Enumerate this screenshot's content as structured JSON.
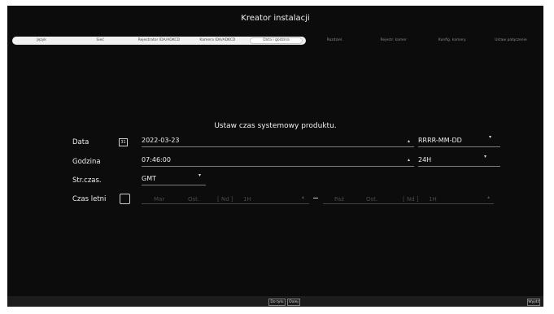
{
  "window": {
    "title": "Kreator instalacji"
  },
  "steps": [
    {
      "label": "Język",
      "state": "done"
    },
    {
      "label": "Sieć",
      "state": "done"
    },
    {
      "label": "Rejestrator IDA/ADKCD",
      "state": "done"
    },
    {
      "label": "Kamera IDA/ADKCD",
      "state": "done"
    },
    {
      "label": "Data i godzina",
      "state": "current"
    },
    {
      "label": "Rozdziel.",
      "state": "todo"
    },
    {
      "label": "Rejestr. kamer",
      "state": "todo"
    },
    {
      "label": "Konfig. kamery",
      "state": "todo"
    },
    {
      "label": "Ustaw połączenie",
      "state": "todo"
    }
  ],
  "heading": "Ustaw czas systemowy produktu.",
  "form": {
    "date": {
      "label": "Data",
      "icon": "calendar-icon",
      "icon_text": "31",
      "value": "2022-03-23",
      "format": "RRRR-MM-DD"
    },
    "time": {
      "label": "Godzina",
      "value": "07:46:00",
      "format": "24H"
    },
    "timezone": {
      "label": "Str.czas.",
      "value": "GMT"
    },
    "dst": {
      "label": "Czas letni",
      "checked": false,
      "start": {
        "month": "Mar",
        "week": "Ost.",
        "day": "[ Nd ]",
        "hour": "1H"
      },
      "end": {
        "month": "Paź",
        "week": "Ost.",
        "day": "[ Nd ]",
        "hour": "1H"
      }
    }
  },
  "footer": {
    "prev_label": "Do tyłu",
    "next_label": "Dalej",
    "exit_label": "Wyjdź"
  },
  "colors": {
    "background": "#0c0c0c",
    "text": "#f0f0f0",
    "step_done": "#f1f1f1"
  }
}
